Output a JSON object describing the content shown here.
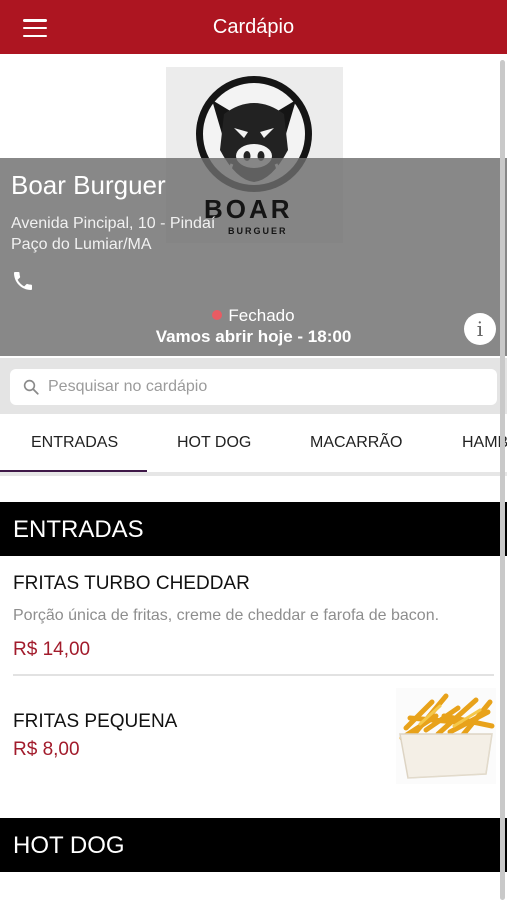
{
  "appbar": {
    "title": "Cardápio",
    "menu_icon": "hamburger-menu-icon"
  },
  "store": {
    "logo_word": "BOAR",
    "logo_sub": "BURGUER",
    "name": "Boar Burguer",
    "address_line1": "Avenida Pincipal, 10 - Pindaí",
    "address_line2": "Paço do Lumiar/MA",
    "status": "Fechado",
    "hours": "Vamos abrir hoje - 18:00",
    "info_label": "i",
    "status_color": "#e85c63",
    "brand_color": "#ad1521"
  },
  "search": {
    "placeholder": "Pesquisar no cardápio"
  },
  "tabs": [
    {
      "label": "ENTRADAS",
      "active": true
    },
    {
      "label": "HOT DOG"
    },
    {
      "label": "MACARRÃO"
    },
    {
      "label": "HAMBÚRGUER"
    }
  ],
  "sections": [
    {
      "title": "ENTRADAS",
      "items": [
        {
          "title": "FRITAS TURBO CHEDDAR",
          "description": "Porção única de fritas, creme de cheddar e farofa de bacon.",
          "price": "R$ 14,00"
        },
        {
          "title": "FRITAS PEQUENA",
          "price": "R$ 8,00"
        }
      ]
    },
    {
      "title": "HOT DOG"
    }
  ],
  "price_color": "#a21b2b"
}
